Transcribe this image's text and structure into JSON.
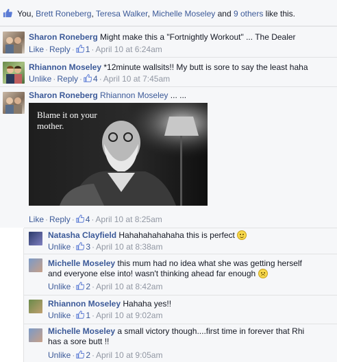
{
  "likes_bar": {
    "prefix": "You,",
    "names": [
      "Brett Roneberg",
      "Teresa Walker",
      "Michelle Moseley"
    ],
    "and_text": "and",
    "others_link": "9 others",
    "suffix": "like this."
  },
  "comments": [
    {
      "author": "Sharon Roneberg",
      "text": "Might make this a \"Fortnightly Workout\" ... The Dealer",
      "like_action": "Like",
      "reply_action": "Reply",
      "like_count": "1",
      "timestamp": "April 10 at 6:24am"
    },
    {
      "author": "Rhiannon Moseley",
      "text": "*12minute wallsits!! My butt is sore to say the least haha",
      "like_action": "Unlike",
      "reply_action": "Reply",
      "like_count": "4",
      "timestamp": "April 10 at 7:45am"
    },
    {
      "author": "Sharon Roneberg",
      "tagged": "Rhiannon Moseley",
      "text": "... ...",
      "image_caption": "Blame it on your\nmother.",
      "like_action": "Like",
      "reply_action": "Reply",
      "like_count": "4",
      "timestamp": "April 10 at 8:25am"
    }
  ],
  "replies": [
    {
      "author": "Natasha Clayfield",
      "text": "Hahahahahahaha this is perfect",
      "emoji": "smile",
      "like_action": "Unlike",
      "like_count": "3",
      "timestamp": "April 10 at 8:38am"
    },
    {
      "author": "Michelle Moseley",
      "text_line1": "this mum had no idea what she was getting herself",
      "text_line2": "and everyone else into! wasn't thinking ahead far enough",
      "emoji": "sad",
      "like_action": "Unlike",
      "like_count": "2",
      "timestamp": "April 10 at 8:42am"
    },
    {
      "author": "Rhiannon Moseley",
      "text": "Hahaha yes!!",
      "like_action": "Unlike",
      "like_count": "1",
      "timestamp": "April 10 at 9:02am"
    },
    {
      "author": "Michelle Moseley",
      "text_line1": "a small victory though....first time in forever that Rhi",
      "text_line2": "has a sore butt !!",
      "like_action": "Unlike",
      "like_count": "2",
      "timestamp": "April 10 at 9:05am"
    }
  ],
  "separator": "·",
  "colors": {
    "link": "#3b5998",
    "meta": "#9197a3",
    "bg": "#f6f7f9"
  },
  "icons": {
    "like": "thumbs-up-icon"
  }
}
